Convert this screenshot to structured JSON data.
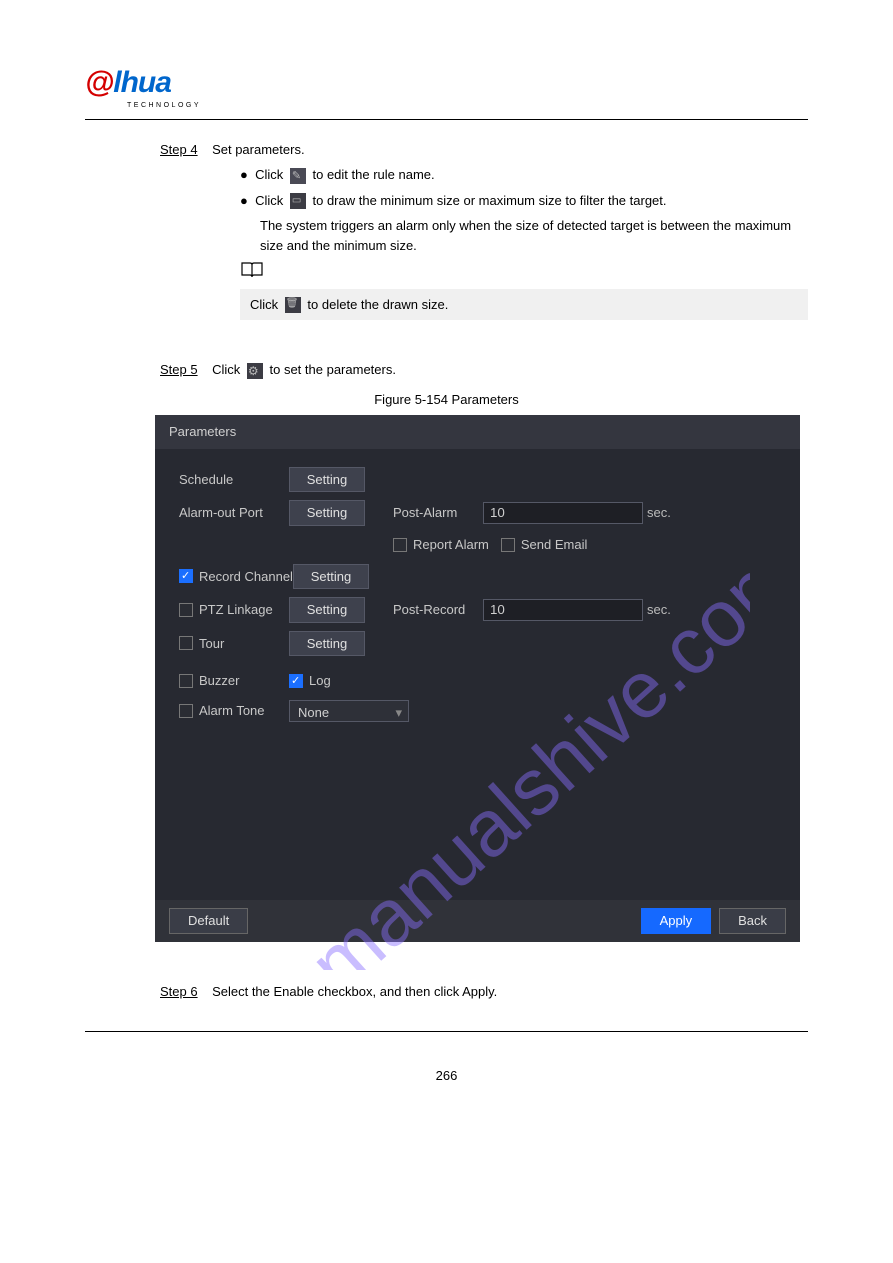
{
  "logo": {
    "text_a": "a",
    "text_rest": "lhua",
    "sub": "TECHNOLOGY"
  },
  "step4": {
    "label": "Step 4",
    "line1": "Set parameters.",
    "bullet1_a": "Click",
    "bullet1_b": "to edit the rule name.",
    "bullet2_a": "Click",
    "bullet2_b": "to draw the minimum size or maximum size to filter the target.",
    "bullet2_c": "The system triggers an alarm only when the size of detected target is between the maximum size and the minimum size.",
    "noteLine": "Click",
    "noteLine_b": "to delete the drawn size."
  },
  "bookIcon": "📖",
  "step5": {
    "label": "Step 5",
    "line1_a": "Click",
    "line1_b": "to set the parameters.",
    "figureCaption": "Figure 5-154 Parameters"
  },
  "ui": {
    "title": "Parameters",
    "schedule": "Schedule",
    "alarmOutPort": "Alarm-out Port",
    "reportAlarm": "Report Alarm",
    "sendEmail": "Send Email",
    "recordChannel": "Record Channel",
    "ptzLinkage": "PTZ Linkage",
    "tour": "Tour",
    "buzzer": "Buzzer",
    "log": "Log",
    "alarmTone": "Alarm Tone",
    "postAlarm": "Post-Alarm",
    "postRecord": "Post-Record",
    "postAlarmValue": "10",
    "postRecordValue": "10",
    "sec": "sec.",
    "setting": "Setting",
    "none": "None",
    "default": "Default",
    "apply": "Apply",
    "back": "Back"
  },
  "step6": {
    "label": "Step 6",
    "line1": "Select the Enable checkbox, and then click Apply."
  },
  "pageNumber": "266"
}
